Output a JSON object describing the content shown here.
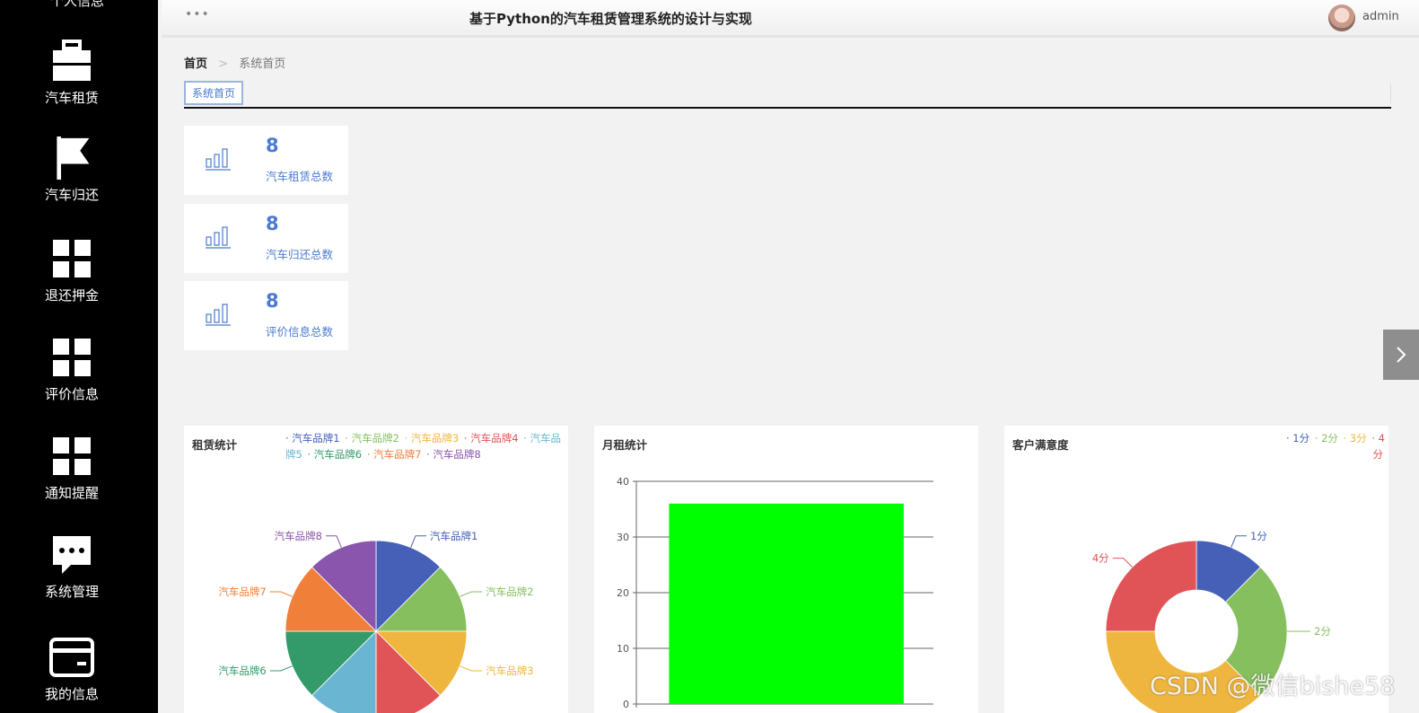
{
  "sidebar": {
    "partial_label": "个人信息",
    "items": [
      {
        "label": "汽车租赁",
        "icon": "briefcase-icon"
      },
      {
        "label": "汽车归还",
        "icon": "flag-icon"
      },
      {
        "label": "退还押金",
        "icon": "grid-icon"
      },
      {
        "label": "评价信息",
        "icon": "grid-icon"
      },
      {
        "label": "通知提醒",
        "icon": "grid-icon"
      },
      {
        "label": "系统管理",
        "icon": "chat-icon"
      },
      {
        "label": "我的信息",
        "icon": "card-icon"
      }
    ]
  },
  "header": {
    "menu_dots": "•••",
    "title": "基于Python的汽车租赁管理系统的设计与实现",
    "username": "admin"
  },
  "breadcrumb": {
    "home": "首页",
    "separator": ">",
    "current": "系统首页"
  },
  "tabs": [
    {
      "label": "系统首页"
    }
  ],
  "stats": [
    {
      "value": "8",
      "label": "汽车租赁总数"
    },
    {
      "value": "8",
      "label": "汽车归还总数"
    },
    {
      "value": "8",
      "label": "评价信息总数"
    }
  ],
  "colors": {
    "accent": "#4a7bd0",
    "sidebar_bg": "#000000",
    "palette": [
      "#4660b8",
      "#86bf5e",
      "#efb63f",
      "#e05457",
      "#6ab6d2",
      "#339a6a",
      "#f07f3a",
      "#8a55ad"
    ]
  },
  "chart_data": [
    {
      "type": "pie",
      "title": "租赁统计",
      "legend_position": "top-right",
      "categories": [
        "汽车品牌1",
        "汽车品牌2",
        "汽车品牌3",
        "汽车品牌4",
        "汽车品牌5",
        "汽车品牌6",
        "汽车品牌7",
        "汽车品牌8"
      ],
      "values": [
        1,
        1,
        1,
        1,
        1,
        1,
        1,
        1
      ]
    },
    {
      "type": "bar",
      "title": "月租统计",
      "categories": [
        ""
      ],
      "values": [
        36
      ],
      "ylim": [
        0,
        40
      ],
      "yticks": [
        "0",
        "10",
        "20",
        "30",
        "40"
      ],
      "bar_color": "#00ff00",
      "grid": true
    },
    {
      "type": "pie",
      "subtype": "donut",
      "title": "客户满意度",
      "legend_position": "top-right",
      "categories": [
        "1分",
        "2分",
        "3分",
        "4分"
      ],
      "values": [
        1,
        2,
        3,
        2
      ]
    }
  ],
  "watermark": "CSDN @微信bishe58"
}
